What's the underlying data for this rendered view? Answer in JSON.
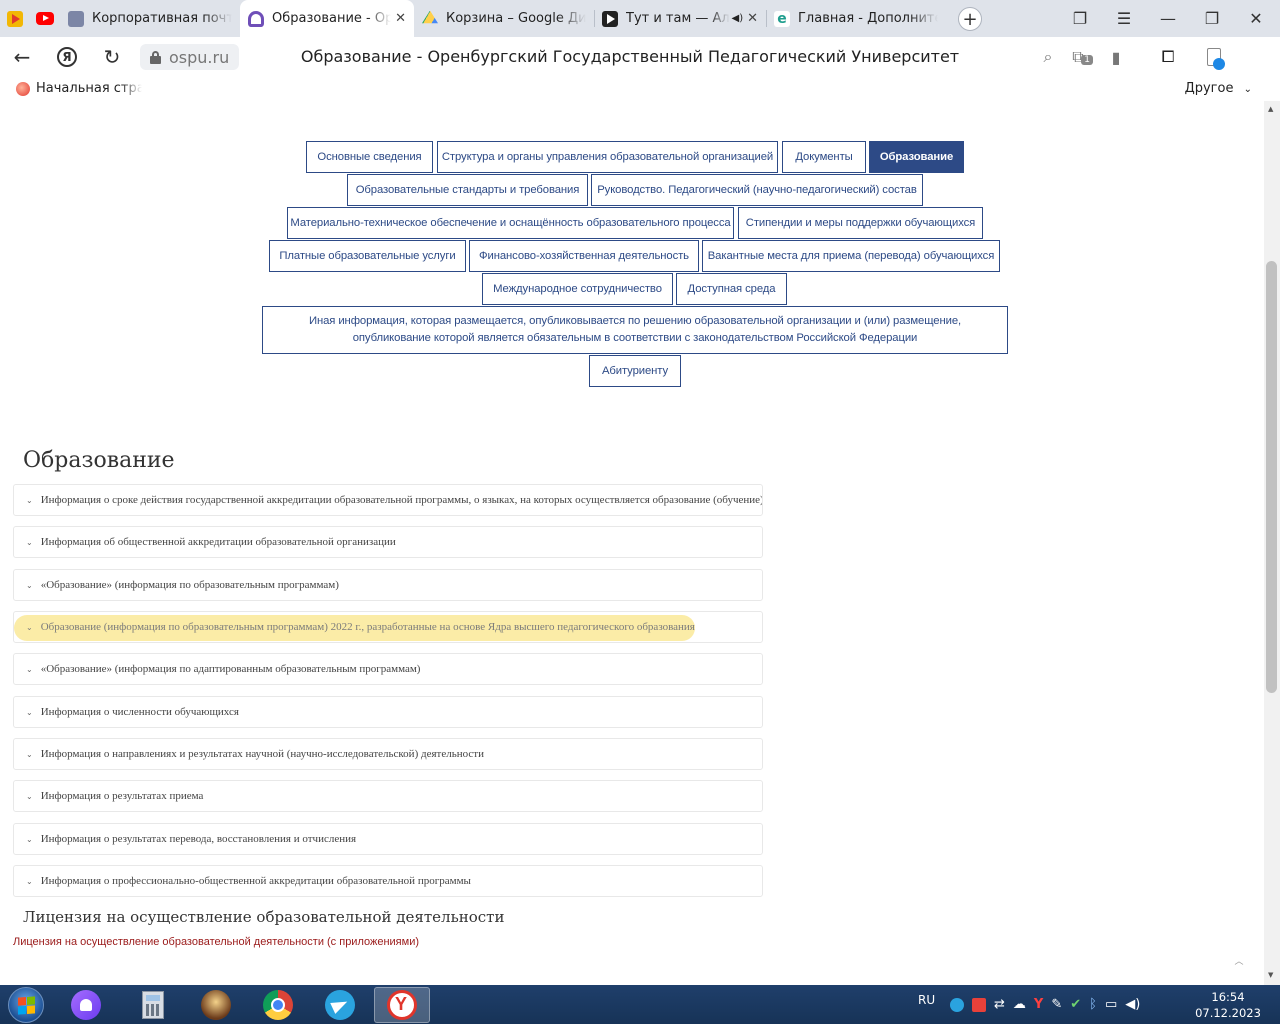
{
  "browser": {
    "tabs": [
      {
        "title": "Корпоративная почта",
        "favicon": "mail-icon",
        "active": false
      },
      {
        "title": "Образование - Оренбургский",
        "favicon": "ospu-icon",
        "active": true
      },
      {
        "title": "Корзина – Google Диск",
        "favicon": "google-drive-icon",
        "active": false
      },
      {
        "title": "Тут и там — Алексей",
        "favicon": "music-play-icon",
        "active": false,
        "audio": true
      },
      {
        "title": "Главная - Дополнительное",
        "favicon": "edu-site-icon",
        "active": false
      }
    ],
    "url": "ospu.ru",
    "page_title": "Образование - Оренбургский Государственный Педагогический Университет",
    "tab_badge": "1",
    "bookmarks": {
      "home": "Начальная страница",
      "other": "Другое"
    },
    "colors": {
      "tabstrip": "#dfe3ea",
      "accent": "#2d4a86"
    }
  },
  "nav": {
    "buttons": [
      "Основные сведения",
      "Структура и органы управления образовательной организацией",
      "Документы",
      "Образование",
      "Образовательные стандарты и требования",
      "Руководство. Педагогический (научно-педагогический) состав",
      "Материально-техническое обеспечение и оснащённость образовательного процесса",
      "Стипендии и меры поддержки обучающихся",
      "Платные образовательные услуги",
      "Финансово-хозяйственная деятельность",
      "Вакантные места для приема (перевода) обучающихся",
      "Международное сотрудничество",
      "Доступная среда",
      "Иная информация, которая размещается, опубликовывается по решению образовательной организации и (или) размещение, опубликование которой является обязательным в соответствии с законодательством Российской Федерации",
      "Абитуриенту"
    ],
    "active_index": 3
  },
  "content": {
    "heading": "Образование",
    "accordion": [
      "Информация о сроке действия государственной аккредитации образовательной программы, о языках, на которых осуществляется образование (обучение)",
      "Информация об общественной аккредитации образовательной организации",
      "«Образование» (информация по образовательным программам)",
      "Образование (информация по образовательным программам) 2022 г., разработанные на основе Ядра высшего педагогического образования",
      "«Образование» (информация по адаптированным образовательным программам)",
      "Информация о численности обучающихся",
      "Информация о направлениях и результатах научной (научно-исследовательской) деятельности",
      "Информация о результатах приема",
      "Информация о результатах перевода, восстановления и отчисления",
      "Информация о профессионально-общественной аккредитации образовательной программы"
    ],
    "highlighted_index": 3,
    "license_heading": "Лицензия на осуществление образовательной деятельности",
    "license_link": "Лицензия на осуществление образовательной деятельности (с приложениями)"
  },
  "taskbar": {
    "apps": [
      "alice-icon",
      "calculator-icon",
      "game-icon",
      "chrome-icon",
      "telegram-icon",
      "yandex-browser-icon"
    ],
    "active_app": "yandex-browser-icon",
    "lang": "RU",
    "time": "16:54",
    "date": "07.12.2023"
  }
}
